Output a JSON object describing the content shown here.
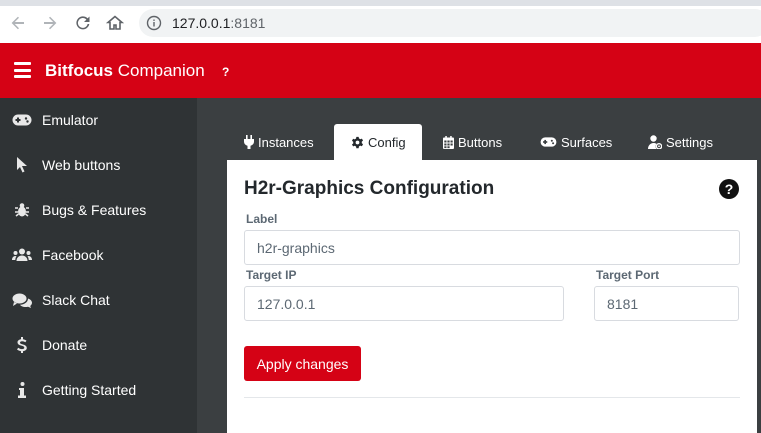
{
  "browser": {
    "url_host": "127.0.0.1",
    "url_port": ":8181"
  },
  "header": {
    "brand_bold": "Bitfocus",
    "brand_rest": " Companion",
    "help": "?"
  },
  "sidebar": {
    "items": [
      {
        "label": "Emulator",
        "icon": "gamepad-icon"
      },
      {
        "label": "Web buttons",
        "icon": "pointer-icon"
      },
      {
        "label": "Bugs & Features",
        "icon": "bug-icon"
      },
      {
        "label": "Facebook",
        "icon": "users-icon"
      },
      {
        "label": "Slack Chat",
        "icon": "comments-icon"
      },
      {
        "label": "Donate",
        "icon": "dollar-icon"
      },
      {
        "label": "Getting Started",
        "icon": "info-icon"
      }
    ]
  },
  "tabs": [
    {
      "label": "Instances",
      "icon": "plug-icon",
      "active": false
    },
    {
      "label": "Config",
      "icon": "gear-icon",
      "active": true
    },
    {
      "label": "Buttons",
      "icon": "calendar-icon",
      "active": false
    },
    {
      "label": "Surfaces",
      "icon": "gamepad-icon",
      "active": false
    },
    {
      "label": "Settings",
      "icon": "user-cog-icon",
      "active": false
    }
  ],
  "config": {
    "title": "H2r-Graphics Configuration",
    "help": "?",
    "label_label": "Label",
    "label_value": "h2r-graphics",
    "target_ip_label": "Target IP",
    "target_ip_value": "127.0.0.1",
    "target_port_label": "Target Port",
    "target_port_value": "8181",
    "apply_label": "Apply changes"
  },
  "colors": {
    "brand_red": "#d50215",
    "sidebar_bg": "#2f3335"
  }
}
